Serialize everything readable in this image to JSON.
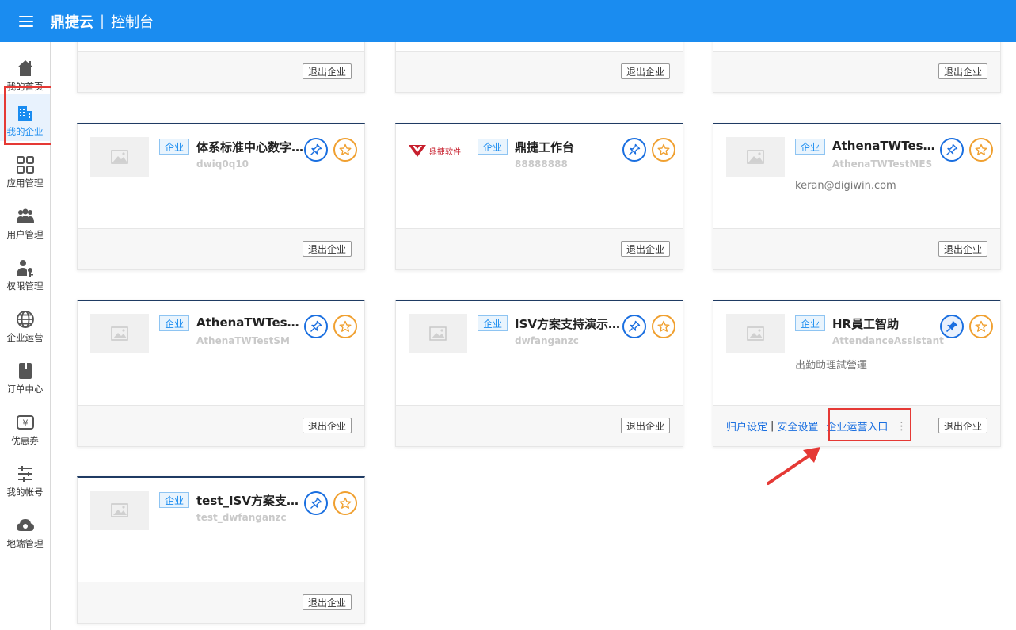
{
  "header": {
    "brand": "鼎捷云",
    "separator": "|",
    "title": "控制台"
  },
  "sidebar": {
    "items": [
      {
        "label": "我的首页",
        "icon": "home-icon"
      },
      {
        "label": "我的企业",
        "icon": "building-icon",
        "active": true
      },
      {
        "label": "应用管理",
        "icon": "app-grid-icon"
      },
      {
        "label": "用户管理",
        "icon": "users-icon"
      },
      {
        "label": "权限管理",
        "icon": "user-key-icon"
      },
      {
        "label": "企业运营",
        "icon": "globe-icon"
      },
      {
        "label": "订单中心",
        "icon": "book-icon"
      },
      {
        "label": "优惠券",
        "icon": "coupon-icon"
      },
      {
        "label": "我的帐号",
        "icon": "sliders-icon"
      },
      {
        "label": "地端管理",
        "icon": "cloud-icon"
      }
    ]
  },
  "common": {
    "tag": "企业",
    "exit": "退出企业"
  },
  "cards": [
    {
      "name": "体系标准中心数字化...",
      "id": "dwiq0q10",
      "desc": ""
    },
    {
      "name": "鼎捷工作台",
      "id": "88888888",
      "desc": "",
      "logo_text": "鼎捷软件"
    },
    {
      "name": "AthenaTWTestMES",
      "id": "AthenaTWTestMES",
      "desc": "keran@digiwin.com"
    },
    {
      "name": "AthenaTWTestSM",
      "id": "AthenaTWTestSM",
      "desc": ""
    },
    {
      "name": "ISV方案支持演示企业",
      "id": "dwfanganzc",
      "desc": ""
    },
    {
      "name": "HR員工智助",
      "id": "AttendanceAssistant",
      "desc": "出勤助理試營運",
      "pinned": true
    },
    {
      "name": "test_ISV方案支持演示",
      "id": "test_dwfanganzc",
      "desc": ""
    }
  ],
  "hr_links": {
    "a": "归户设定",
    "sep": "|",
    "b": "安全设置",
    "c": "企业运营入口",
    "more": "⋮"
  },
  "colors": {
    "primary": "#1a8cf0",
    "highlight": "#e53935",
    "star": "#f0a030"
  }
}
